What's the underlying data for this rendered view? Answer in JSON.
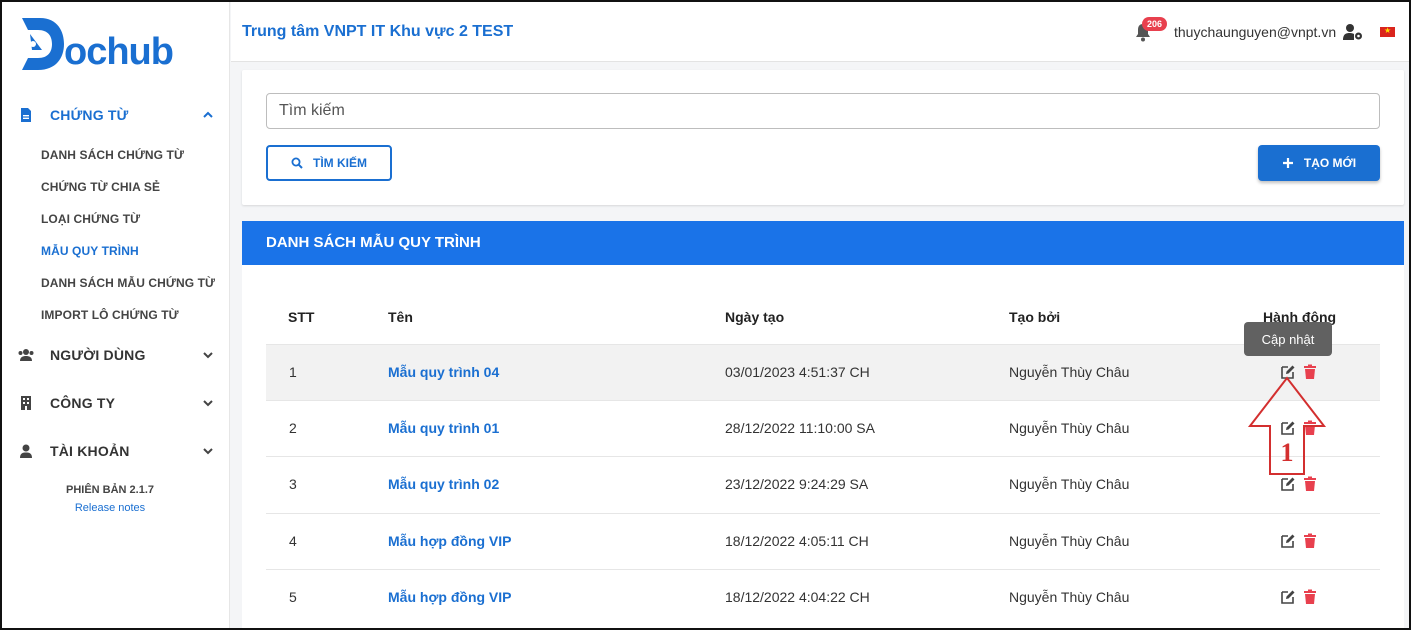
{
  "app": {
    "logo_text": "ochub",
    "org_title": "Trung tâm VNPT IT Khu vực 2 TEST",
    "notification_count": "206",
    "user_email": "thuychaunguyen@vnpt.vn"
  },
  "sidebar": {
    "groups": [
      {
        "label": "CHỨNG TỪ",
        "icon": "document-icon",
        "expanded": true
      },
      {
        "label": "NGƯỜI DÙNG",
        "icon": "users-icon",
        "expanded": false
      },
      {
        "label": "CÔNG TY",
        "icon": "building-icon",
        "expanded": false
      },
      {
        "label": "TÀI KHOẢN",
        "icon": "user-icon",
        "expanded": false
      }
    ],
    "sub_items": [
      "DANH SÁCH CHỨNG TỪ",
      "CHỨNG TỪ CHIA SẺ",
      "LOẠI CHỨNG TỪ",
      "MẪU QUY TRÌNH",
      "DANH SÁCH MẪU CHỨNG TỪ",
      "IMPORT LÔ CHỨNG TỪ"
    ],
    "active_sub_item": "MẪU QUY TRÌNH",
    "version": "PHIÊN BẢN 2.1.7",
    "release_notes": "Release notes"
  },
  "search": {
    "placeholder": "Tìm kiếm",
    "search_label": "TÌM KIẾM",
    "create_label": "TẠO MỚI"
  },
  "list": {
    "title": "DANH SÁCH MẪU QUY TRÌNH",
    "columns": [
      "STT",
      "Tên",
      "Ngày tạo",
      "Tạo bởi",
      "Hành động"
    ],
    "rows": [
      {
        "stt": "1",
        "name": "Mẫu quy trình 04",
        "created": "03/01/2023 4:51:37 CH",
        "by": "Nguyễn Thùy Châu"
      },
      {
        "stt": "2",
        "name": "Mẫu quy trình 01",
        "created": "28/12/2022 11:10:00 SA",
        "by": "Nguyễn Thùy Châu"
      },
      {
        "stt": "3",
        "name": "Mẫu quy trình 02",
        "created": "23/12/2022 9:24:29 SA",
        "by": "Nguyễn Thùy Châu"
      },
      {
        "stt": "4",
        "name": "Mẫu hợp đồng VIP",
        "created": "18/12/2022 4:05:11 CH",
        "by": "Nguyễn Thùy Châu"
      },
      {
        "stt": "5",
        "name": "Mẫu hợp đồng VIP",
        "created": "18/12/2022 4:04:22 CH",
        "by": "Nguyễn Thùy Châu"
      }
    ]
  },
  "tooltip": "Cập nhật",
  "annotation": "1",
  "colors": {
    "primary": "#1a6fd1",
    "header_bar": "#1a73e8",
    "danger": "#e8404e",
    "annotation": "#d32f2f"
  }
}
